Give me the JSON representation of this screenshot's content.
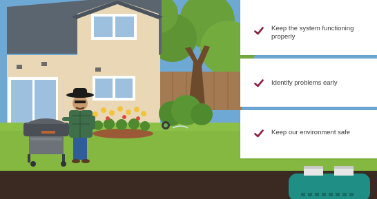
{
  "checklist": {
    "items": [
      {
        "label": "Keep the system functioning properly"
      },
      {
        "label": "Identify problems early"
      },
      {
        "label": "Keep our environment safe"
      }
    ]
  },
  "icons": {
    "check": "checkmark-icon"
  },
  "colors": {
    "check": "#8b1c3b",
    "sky": "#6ea9d6",
    "grass": "#8cbf46",
    "soil": "#3a2a22",
    "house_siding": "#e9d7b6",
    "roof": "#5b6570",
    "septic_tank": "#1f8f86"
  }
}
